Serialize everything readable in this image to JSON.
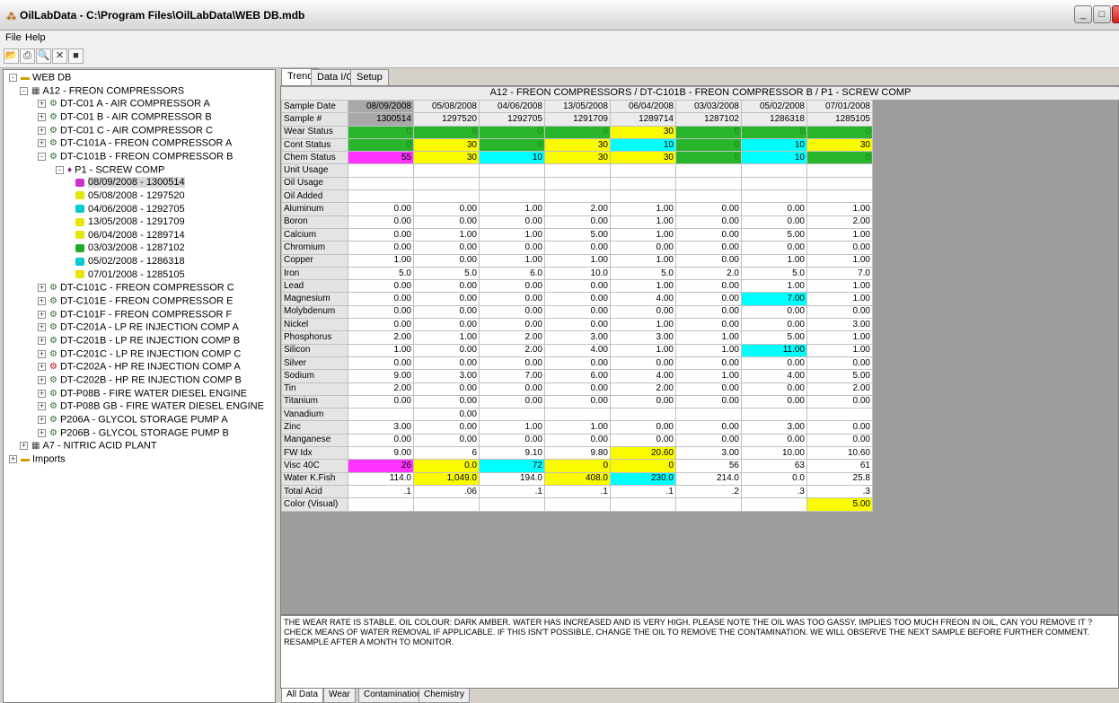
{
  "window": {
    "title": "OilLabData - C:\\Program Files\\OilLabData\\WEB DB.mdb",
    "icon": "app-icon"
  },
  "menu": {
    "file": "File",
    "help": "Help"
  },
  "toolbar": [
    "open-icon",
    "print-icon",
    "print-preview-icon",
    "delete-icon",
    "save-icon"
  ],
  "tree": [
    {
      "label": "WEB DB",
      "icon": "folder",
      "level": 0,
      "exp": "-"
    },
    {
      "label": "A12 - FREON COMPRESSORS",
      "icon": "plant",
      "level": 1,
      "exp": "-"
    },
    {
      "label": "DT-C01 A - AIR COMPRESSOR A",
      "icon": "comp",
      "level": 2,
      "exp": "+"
    },
    {
      "label": "DT-C01 B - AIR COMPRESSOR B",
      "icon": "comp",
      "level": 2,
      "exp": "+"
    },
    {
      "label": "DT-C01 C - AIR COMPRESSOR C",
      "icon": "comp",
      "level": 2,
      "exp": "+"
    },
    {
      "label": "DT-C101A - FREON COMPRESSOR A",
      "icon": "comp",
      "level": 2,
      "exp": "+"
    },
    {
      "label": "DT-C101B - FREON COMPRESSOR B",
      "icon": "comp",
      "level": 2,
      "exp": "-"
    },
    {
      "label": "P1 - SCREW COMP",
      "icon": "pump",
      "level": 3,
      "exp": "-"
    },
    {
      "label": "08/09/2008 - 1300514",
      "icon": "bottle",
      "color": "#cc33cc",
      "level": 4,
      "selected": true
    },
    {
      "label": "05/08/2008 - 1297520",
      "icon": "bottle",
      "color": "#e6e600",
      "level": 4
    },
    {
      "label": "04/06/2008 - 1292705",
      "icon": "bottle",
      "color": "#00cccc",
      "level": 4
    },
    {
      "label": "13/05/2008 - 1291709",
      "icon": "bottle",
      "color": "#e6e600",
      "level": 4
    },
    {
      "label": "06/04/2008 - 1289714",
      "icon": "bottle",
      "color": "#e6e600",
      "level": 4
    },
    {
      "label": "03/03/2008 - 1287102",
      "icon": "bottle",
      "color": "#22aa22",
      "level": 4
    },
    {
      "label": "05/02/2008 - 1286318",
      "icon": "bottle",
      "color": "#00cccc",
      "level": 4
    },
    {
      "label": "07/01/2008 - 1285105",
      "icon": "bottle",
      "color": "#e6e600",
      "level": 4
    },
    {
      "label": "DT-C101C - FREON COMPRESSOR C",
      "icon": "comp",
      "level": 2,
      "exp": "+"
    },
    {
      "label": "DT-C101E - FREON COMPRESSOR E",
      "icon": "comp",
      "level": 2,
      "exp": "+"
    },
    {
      "label": "DT-C101F - FREON COMPRESSOR F",
      "icon": "comp",
      "level": 2,
      "exp": "+"
    },
    {
      "label": "DT-C201A - LP RE INJECTION COMP A",
      "icon": "comp",
      "level": 2,
      "exp": "+"
    },
    {
      "label": "DT-C201B - LP RE INJECTION COMP B",
      "icon": "comp",
      "level": 2,
      "exp": "+"
    },
    {
      "label": "DT-C201C - LP RE INJECTION COMP C",
      "icon": "comp",
      "level": 2,
      "exp": "+"
    },
    {
      "label": "DT-C202A - HP RE INJECTION COMP A",
      "icon": "comp-red",
      "level": 2,
      "exp": "+"
    },
    {
      "label": "DT-C202B - HP RE INJECTION COMP B",
      "icon": "comp",
      "level": 2,
      "exp": "+"
    },
    {
      "label": "DT-P08B - FIRE WATER DIESEL ENGINE",
      "icon": "comp",
      "level": 2,
      "exp": "+"
    },
    {
      "label": "DT-P08B GB - FIRE WATER DIESEL ENGINE",
      "icon": "comp",
      "level": 2,
      "exp": "+"
    },
    {
      "label": "P206A - GLYCOL STORAGE PUMP A",
      "icon": "comp",
      "level": 2,
      "exp": "+"
    },
    {
      "label": "P206B - GLYCOL STORAGE PUMP B",
      "icon": "comp",
      "level": 2,
      "exp": "+"
    },
    {
      "label": "A7 - NITRIC ACID PLANT",
      "icon": "plant",
      "level": 1,
      "exp": "+"
    },
    {
      "label": "Imports",
      "icon": "folder",
      "level": 0,
      "exp": "+"
    }
  ],
  "tabs_top": [
    "Trend",
    "Data I/O",
    "Setup"
  ],
  "grid": {
    "title": "A12 - FREON COMPRESSORS / DT-C101B - FREON COMPRESSOR B / P1 - SCREW COMP",
    "rows": [
      {
        "label": "Sample Date",
        "hdr": true,
        "cells": [
          "08/09/2008",
          "05/08/2008",
          "04/06/2008",
          "13/05/2008",
          "06/04/2008",
          "03/03/2008",
          "05/02/2008",
          "07/01/2008"
        ]
      },
      {
        "label": "Sample #",
        "hdr": true,
        "cells": [
          "1300514",
          "1297520",
          "1292705",
          "1291709",
          "1289714",
          "1287102",
          "1286318",
          "1285105"
        ]
      },
      {
        "label": "Wear Status",
        "cells": [
          "0",
          "0",
          "0",
          "0",
          "30",
          "0",
          "0",
          "0"
        ],
        "colors": [
          "g",
          "g",
          "g",
          "g",
          "y",
          "g",
          "g",
          "g"
        ]
      },
      {
        "label": "Cont Status",
        "cells": [
          "0",
          "30",
          "0",
          "30",
          "10",
          "0",
          "10",
          "30"
        ],
        "colors": [
          "g",
          "y",
          "g",
          "y",
          "c",
          "g",
          "c",
          "y"
        ]
      },
      {
        "label": "Chem Status",
        "cells": [
          "55",
          "30",
          "10",
          "30",
          "30",
          "0",
          "10",
          "0"
        ],
        "colors": [
          "m",
          "y",
          "c",
          "y",
          "y",
          "g",
          "c",
          "g"
        ]
      },
      {
        "label": "Unit Usage",
        "cells": [
          "",
          "",
          "",
          "",
          "",
          "",
          "",
          ""
        ]
      },
      {
        "label": "Oil Usage",
        "cells": [
          "",
          "",
          "",
          "",
          "",
          "",
          "",
          ""
        ]
      },
      {
        "label": "Oil Added",
        "cells": [
          "",
          "",
          "",
          "",
          "",
          "",
          "",
          ""
        ]
      },
      {
        "label": "Aluminum",
        "cells": [
          "0.00",
          "0.00",
          "1.00",
          "2.00",
          "1.00",
          "0.00",
          "0.00",
          "1.00"
        ]
      },
      {
        "label": "Boron",
        "cells": [
          "0.00",
          "0.00",
          "0.00",
          "0.00",
          "1.00",
          "0.00",
          "0.00",
          "2.00"
        ]
      },
      {
        "label": "Calcium",
        "cells": [
          "0.00",
          "1.00",
          "1.00",
          "5.00",
          "1.00",
          "0.00",
          "5.00",
          "1.00"
        ]
      },
      {
        "label": "Chromium",
        "cells": [
          "0.00",
          "0.00",
          "0.00",
          "0.00",
          "0.00",
          "0.00",
          "0.00",
          "0.00"
        ]
      },
      {
        "label": "Copper",
        "cells": [
          "1.00",
          "0.00",
          "1.00",
          "1.00",
          "1.00",
          "0.00",
          "1.00",
          "1.00"
        ]
      },
      {
        "label": "Iron",
        "cells": [
          "5.0",
          "5.0",
          "6.0",
          "10.0",
          "5.0",
          "2.0",
          "5.0",
          "7.0"
        ]
      },
      {
        "label": "Lead",
        "cells": [
          "0.00",
          "0.00",
          "0.00",
          "0.00",
          "1.00",
          "0.00",
          "1.00",
          "1.00"
        ]
      },
      {
        "label": "Magnesium",
        "cells": [
          "0.00",
          "0.00",
          "0.00",
          "0.00",
          "4.00",
          "0.00",
          "7.00",
          "1.00"
        ],
        "colors": [
          "",
          "",
          "",
          "",
          "",
          "",
          "c",
          ""
        ]
      },
      {
        "label": "Molybdenum",
        "cells": [
          "0.00",
          "0.00",
          "0.00",
          "0.00",
          "0.00",
          "0.00",
          "0.00",
          "0.00"
        ]
      },
      {
        "label": "Nickel",
        "cells": [
          "0.00",
          "0.00",
          "0.00",
          "0.00",
          "1.00",
          "0.00",
          "0.00",
          "3.00"
        ]
      },
      {
        "label": "Phosphorus",
        "cells": [
          "2.00",
          "1.00",
          "2.00",
          "3.00",
          "3.00",
          "1.00",
          "5.00",
          "1.00"
        ]
      },
      {
        "label": "Silicon",
        "cells": [
          "1.00",
          "0.00",
          "2.00",
          "4.00",
          "1.00",
          "1.00",
          "11.00",
          "1.00"
        ],
        "colors": [
          "",
          "",
          "",
          "",
          "",
          "",
          "c",
          ""
        ]
      },
      {
        "label": "Silver",
        "cells": [
          "0.00",
          "0.00",
          "0.00",
          "0.00",
          "0.00",
          "0.00",
          "0.00",
          "0.00"
        ]
      },
      {
        "label": "Sodium",
        "cells": [
          "9.00",
          "3.00",
          "7.00",
          "6.00",
          "4.00",
          "1.00",
          "4.00",
          "5.00"
        ]
      },
      {
        "label": "Tin",
        "cells": [
          "2.00",
          "0.00",
          "0.00",
          "0.00",
          "2.00",
          "0.00",
          "0.00",
          "2.00"
        ]
      },
      {
        "label": "Titanium",
        "cells": [
          "0.00",
          "0.00",
          "0.00",
          "0.00",
          "0.00",
          "0.00",
          "0.00",
          "0.00"
        ]
      },
      {
        "label": "Vanadium",
        "cells": [
          "",
          "0.00",
          "",
          "",
          "",
          "",
          "",
          ""
        ]
      },
      {
        "label": "Zinc",
        "cells": [
          "3.00",
          "0.00",
          "1.00",
          "1.00",
          "0.00",
          "0.00",
          "3.00",
          "0.00"
        ]
      },
      {
        "label": "Manganese",
        "cells": [
          "0.00",
          "0.00",
          "0.00",
          "0.00",
          "0.00",
          "0.00",
          "0.00",
          "0.00"
        ]
      },
      {
        "label": "FW Idx",
        "cells": [
          "9.00",
          "6",
          "9.10",
          "9.80",
          "20.60",
          "3.00",
          "10.00",
          "10.60"
        ],
        "colors": [
          "",
          "",
          "",
          "",
          "y",
          "",
          "",
          ""
        ]
      },
      {
        "label": "Visc 40C",
        "cells": [
          "26",
          "0.0",
          "72",
          "0",
          "0",
          "56",
          "63",
          "61"
        ],
        "colors": [
          "m",
          "y",
          "c",
          "y",
          "y",
          "",
          "",
          ""
        ]
      },
      {
        "label": "Water K.Fish",
        "cells": [
          "114.0",
          "1,049.0",
          "194.0",
          "408.0",
          "230.0",
          "214.0",
          "0.0",
          "25.8"
        ],
        "colors": [
          "",
          "y",
          "",
          "y",
          "c",
          "",
          "",
          ""
        ]
      },
      {
        "label": "Total Acid",
        "cells": [
          ".1",
          ".06",
          ".1",
          ".1",
          ".1",
          ".2",
          ".3",
          ".3"
        ]
      },
      {
        "label": "Color (Visual)",
        "cells": [
          "",
          "",
          "",
          "",
          "",
          "",
          "",
          "5.00"
        ],
        "colors": [
          "",
          "",
          "",
          "",
          "",
          "",
          "",
          "y"
        ]
      }
    ]
  },
  "comments": "THE WEAR RATE IS STABLE.  OIL COLOUR: DARK AMBER.  WATER HAS INCREASED AND IS VERY HIGH.  PLEASE NOTE THE OIL WAS TOO GASSY. IMPLIES TOO MUCH FREON IN OIL, CAN YOU REMOVE IT ?  CHECK MEANS OF WATER REMOVAL IF APPLICABLE.  IF THIS ISN'T POSSIBLE, CHANGE THE OIL TO REMOVE THE CONTAMINATION.  WE WILL OBSERVE THE NEXT SAMPLE BEFORE FURTHER COMMENT.  RESAMPLE AFTER A MONTH TO MONITOR.",
  "tabs_bottom": [
    "All Data",
    "Wear",
    "Contamination",
    "Chemistry"
  ]
}
